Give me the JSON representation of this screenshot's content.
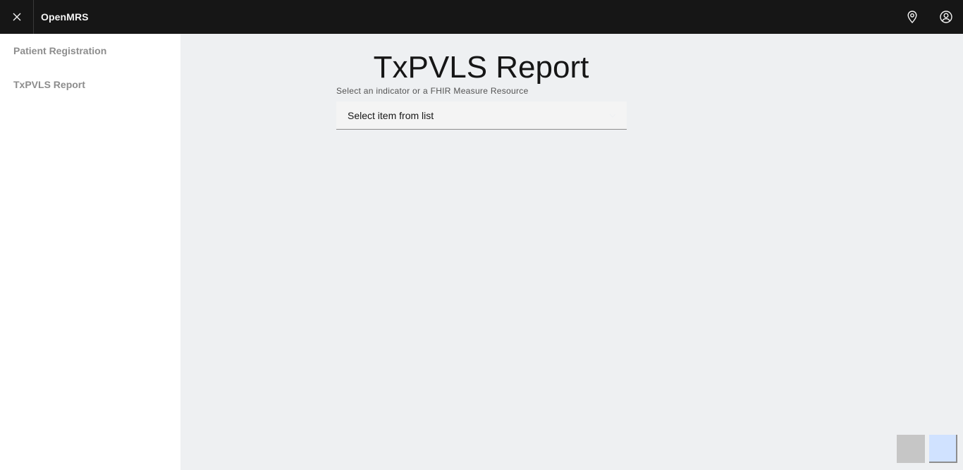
{
  "header": {
    "brand": "OpenMRS",
    "close_icon": "close-icon",
    "location_icon": "location-pin-icon",
    "user_icon": "user-avatar-icon"
  },
  "sidebar": {
    "items": [
      {
        "label": "Patient Registration"
      },
      {
        "label": "TxPVLS Report"
      }
    ]
  },
  "main": {
    "title": "TxPVLS Report",
    "indicator_label": "Select an indicator or a FHIR Measure Resource",
    "indicator_placeholder": "Select item from list"
  },
  "colors": {
    "header_bg": "#161616",
    "sidebar_bg": "#ffffff",
    "main_bg": "#eef0f2",
    "sidebar_text": "#8d8d8d"
  }
}
